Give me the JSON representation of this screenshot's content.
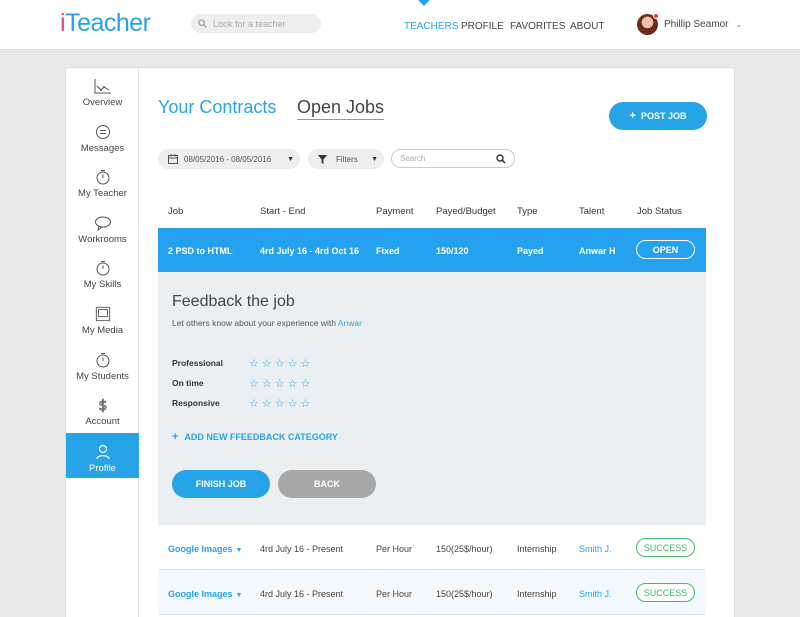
{
  "header": {
    "logo_i": "i",
    "logo_rest": "Teacher",
    "search_placeholder": "Look for a teacher",
    "nav": [
      {
        "label": "TEACHERS",
        "active": true
      },
      {
        "label": "PROFILE",
        "active": false
      },
      {
        "label": "FAVORITES",
        "active": false
      },
      {
        "label": "ABOUT",
        "active": false
      }
    ],
    "user_name": "Phillip Seamor"
  },
  "sidebar": {
    "items": [
      {
        "label": "Overview",
        "icon": "chart-icon"
      },
      {
        "label": "Messages",
        "icon": "message-icon"
      },
      {
        "label": "My Teacher",
        "icon": "stopwatch-icon"
      },
      {
        "label": "Workrooms",
        "icon": "chat-bubble-icon"
      },
      {
        "label": "My Skills",
        "icon": "stopwatch-icon"
      },
      {
        "label": "My Media",
        "icon": "media-icon"
      },
      {
        "label": "My Students",
        "icon": "stopwatch-icon"
      },
      {
        "label": "Account",
        "icon": "dollar-icon"
      },
      {
        "label": "Profile",
        "icon": "user-icon",
        "active": true
      }
    ]
  },
  "main": {
    "tabs": [
      {
        "label": "Your Contracts",
        "active": true
      },
      {
        "label": "Open Jobs",
        "active": false
      }
    ],
    "post_job_label": "POST JOB",
    "filters": {
      "date_range": "08/05/2016 - 08/05/2016",
      "filters_label": "Filters",
      "search_placeholder": "Search"
    },
    "table": {
      "columns": [
        "Job",
        "Start - End",
        "Payment",
        "Payed/Budget",
        "Type",
        "Talent",
        "Job Status"
      ],
      "selected_row": {
        "job": "2 PSD to HTML",
        "dates": "4rd July 16 - 4rd Oct 16",
        "payment": "Fixed",
        "payed_budget": "150/120",
        "type": "Payed",
        "talent": "Anwar H",
        "status": "OPEN"
      },
      "rows": [
        {
          "job": "Google Images",
          "dates": "4rd July 16 - Present",
          "payment": "Per Hour",
          "payed_budget": "150(25$/hour)",
          "type": "Internship",
          "talent": "Smith J.",
          "status": "SUCCESS"
        },
        {
          "job": "Google Images",
          "dates": "4rd July 16 - Present",
          "payment": "Per Hour",
          "payed_budget": "150(25$/hour)",
          "type": "Internship",
          "talent": "Smith J.",
          "status": "SUCCESS"
        }
      ]
    },
    "feedback": {
      "title": "Feedback the job",
      "subtitle_prefix": "Let others know about your experience with ",
      "subtitle_name": "Anwar",
      "criteria": [
        {
          "label": "Professional",
          "rating": 0,
          "max": 5
        },
        {
          "label": "On time",
          "rating": 0,
          "max": 5
        },
        {
          "label": "Responsive",
          "rating": 0,
          "max": 5
        }
      ],
      "add_category_label": "ADD NEW FFEEDBACK CATEGORY",
      "finish_label": "FINISH JOB",
      "back_label": "BACK"
    }
  },
  "colors": {
    "accent": "#27a4e8",
    "selected_row": "#24a2f0",
    "success": "#43b96a",
    "logo_i": "#e6417f"
  }
}
